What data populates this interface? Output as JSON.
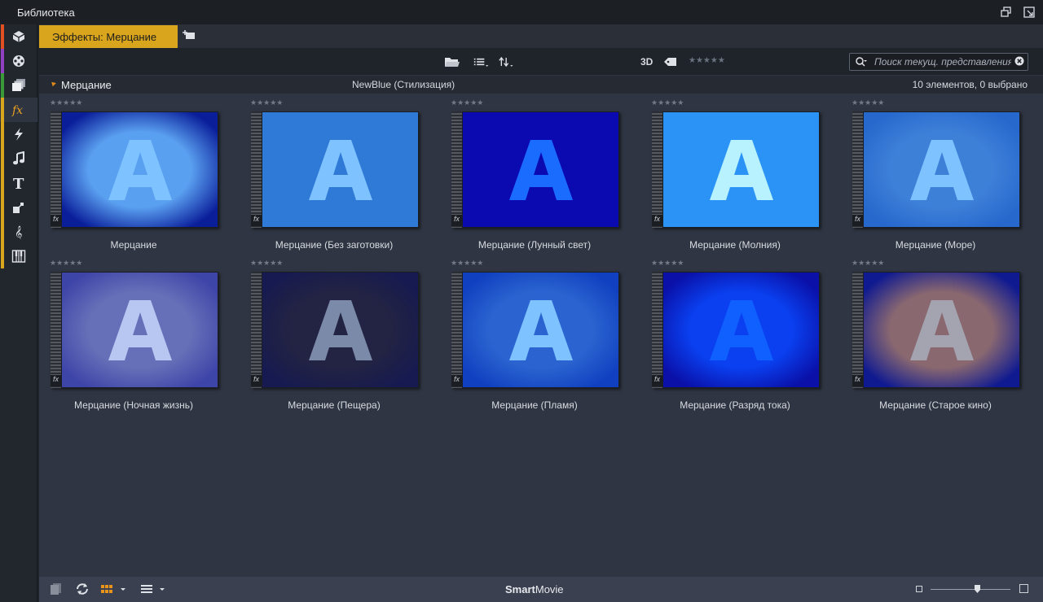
{
  "window": {
    "title": "Библиотека"
  },
  "tabs": [
    {
      "label": "Эффекты: Мерцание",
      "active": true
    }
  ],
  "toolbar": {
    "label_3d": "3D",
    "rating_stars": "★★★★★"
  },
  "search": {
    "placeholder": "Поиск текущ. представления",
    "value": ""
  },
  "section": {
    "name": "Мерцание",
    "subtitle": "NewBlue (Стилизация)",
    "count": "10 элементов, 0 выбрано"
  },
  "colors": {
    "accent": "#d8a51c",
    "sidebar_stripes": [
      "#e05020",
      "#9040c0",
      "#3a9a3a",
      "#d8a51c"
    ]
  },
  "items": [
    {
      "label": "Мерцание",
      "stars": "★★★★★",
      "bg": "#0a1e9a",
      "glow": "#5aa0f0",
      "letter": "#7ec3ff",
      "style": "radial"
    },
    {
      "label": "Мерцание (Без заготовки)",
      "stars": "★★★★★",
      "bg": "#2f7ad6",
      "glow": "#2f7ad6",
      "letter": "#7ec3ff",
      "style": "flat"
    },
    {
      "label": "Мерцание (Лунный свет)",
      "stars": "★★★★★",
      "bg": "#0a0ab0",
      "glow": "#0a0ab0",
      "letter": "#1a6cff",
      "style": "flat"
    },
    {
      "label": "Мерцание (Молния)",
      "stars": "★★★★★",
      "bg": "#2b93f5",
      "glow": "#2b93f5",
      "letter": "#b8f2ff",
      "style": "flat"
    },
    {
      "label": "Мерцание (Море)",
      "stars": "★★★★★",
      "bg": "#2668cc",
      "glow": "#3d80d8",
      "letter": "#7ec3ff",
      "style": "radial"
    },
    {
      "label": "Мерцание (Ночная жизнь)",
      "stars": "★★★★★",
      "bg": "#3e45a8",
      "glow": "#6670b8",
      "letter": "#b8c6f2",
      "style": "radial"
    },
    {
      "label": "Мерцание (Пещера)",
      "stars": "★★★★★",
      "bg": "#161a50",
      "glow": "#232343",
      "letter": "#7a8aa8",
      "style": "radial"
    },
    {
      "label": "Мерцание (Пламя)",
      "stars": "★★★★★",
      "bg": "#1040c0",
      "glow": "#2b64d0",
      "letter": "#7ec3ff",
      "style": "radial"
    },
    {
      "label": "Мерцание (Разряд тока)",
      "stars": "★★★★★",
      "bg": "#0a10a8",
      "glow": "#0a40f0",
      "letter": "#1060ff",
      "style": "radial"
    },
    {
      "label": "Мерцание (Старое кино)",
      "stars": "★★★★★",
      "bg": "#101a90",
      "glow": "#8a6870",
      "letter": "#a3a4b0",
      "style": "radial"
    }
  ],
  "bottombar": {
    "brand_bold": "Smart",
    "brand_rest": "Movie"
  },
  "zoom": {
    "level": 0.58
  }
}
